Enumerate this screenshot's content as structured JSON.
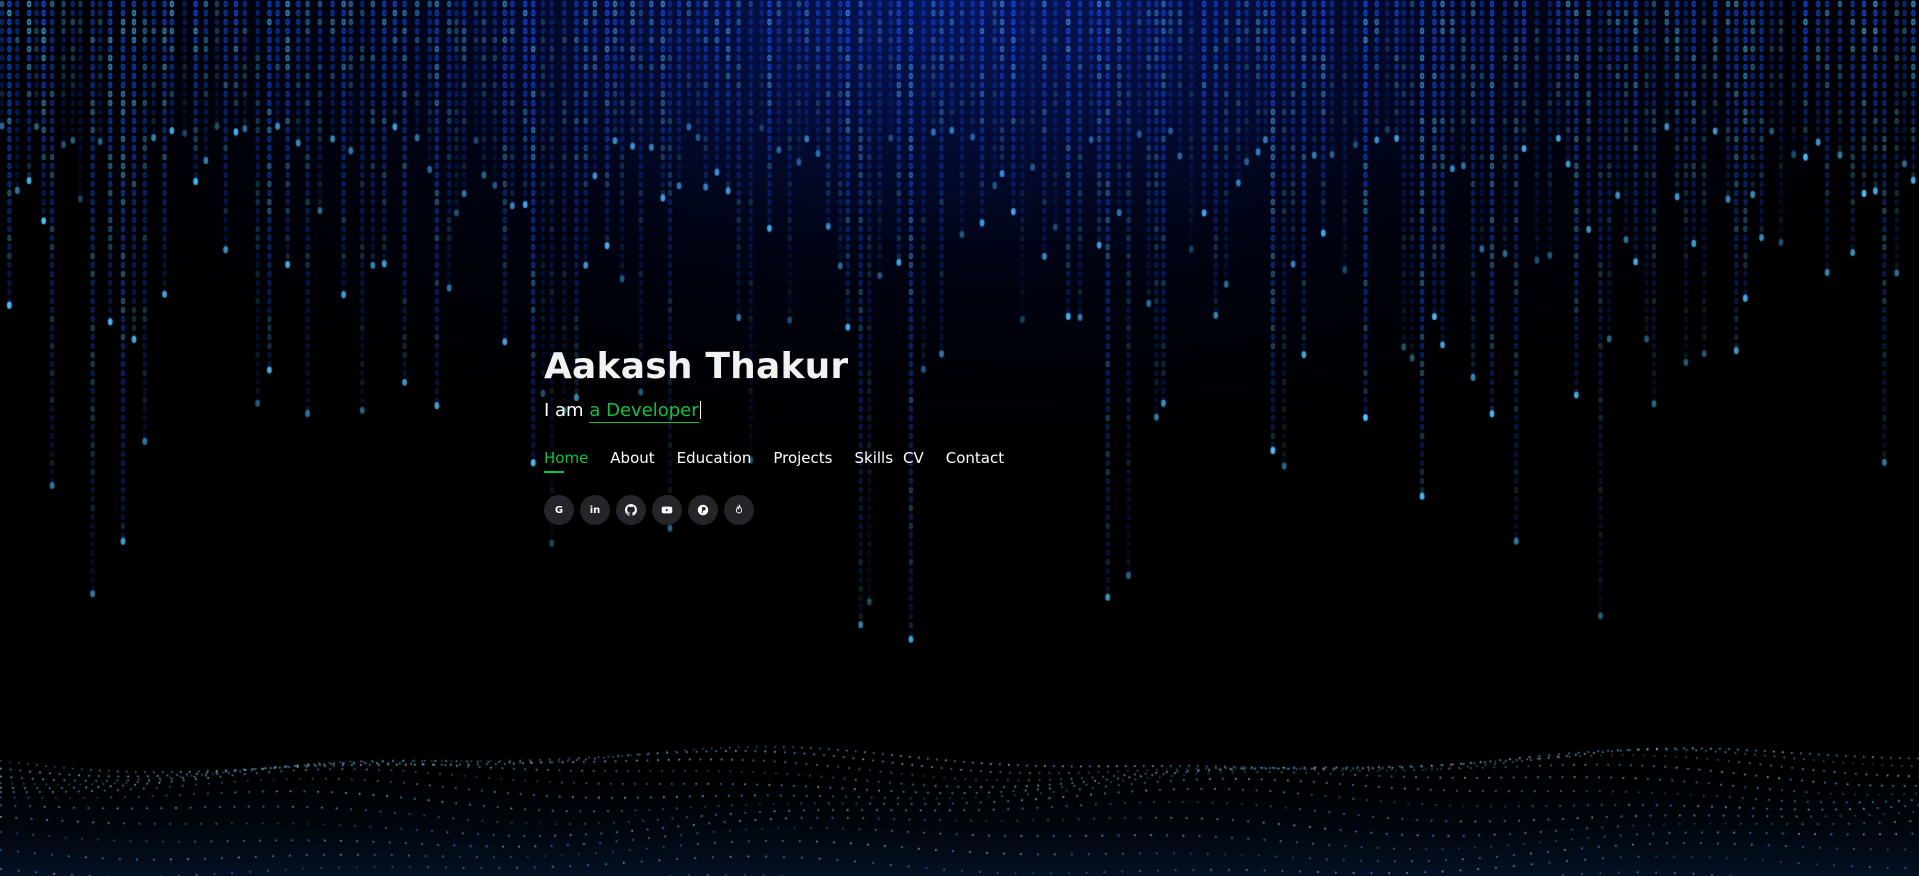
{
  "hero": {
    "name": "Aakash Thakur",
    "tagline_prefix": "I am ",
    "tagline_role": "a Developer"
  },
  "nav": {
    "items": [
      {
        "label": "Home",
        "active": true
      },
      {
        "label": "About",
        "active": false
      },
      {
        "label": "Education",
        "active": false
      },
      {
        "label": "Projects",
        "active": false
      },
      {
        "label": "Skills",
        "active": false
      },
      {
        "label": "CV",
        "active": false
      },
      {
        "label": "Contact",
        "active": false
      }
    ]
  },
  "social": {
    "links": [
      {
        "icon": "google-icon",
        "glyph": "G"
      },
      {
        "icon": "linkedin-icon",
        "glyph": "in"
      },
      {
        "icon": "github-icon",
        "glyph": ""
      },
      {
        "icon": "youtube-icon",
        "glyph": ""
      },
      {
        "icon": "pinterest-icon",
        "glyph": ""
      },
      {
        "icon": "fire-icon",
        "glyph": ""
      }
    ]
  },
  "colors": {
    "accent": "#12c23a",
    "background": "#000000",
    "rain": "#1a5cff",
    "rain_highlight": "#4fc3ff"
  }
}
